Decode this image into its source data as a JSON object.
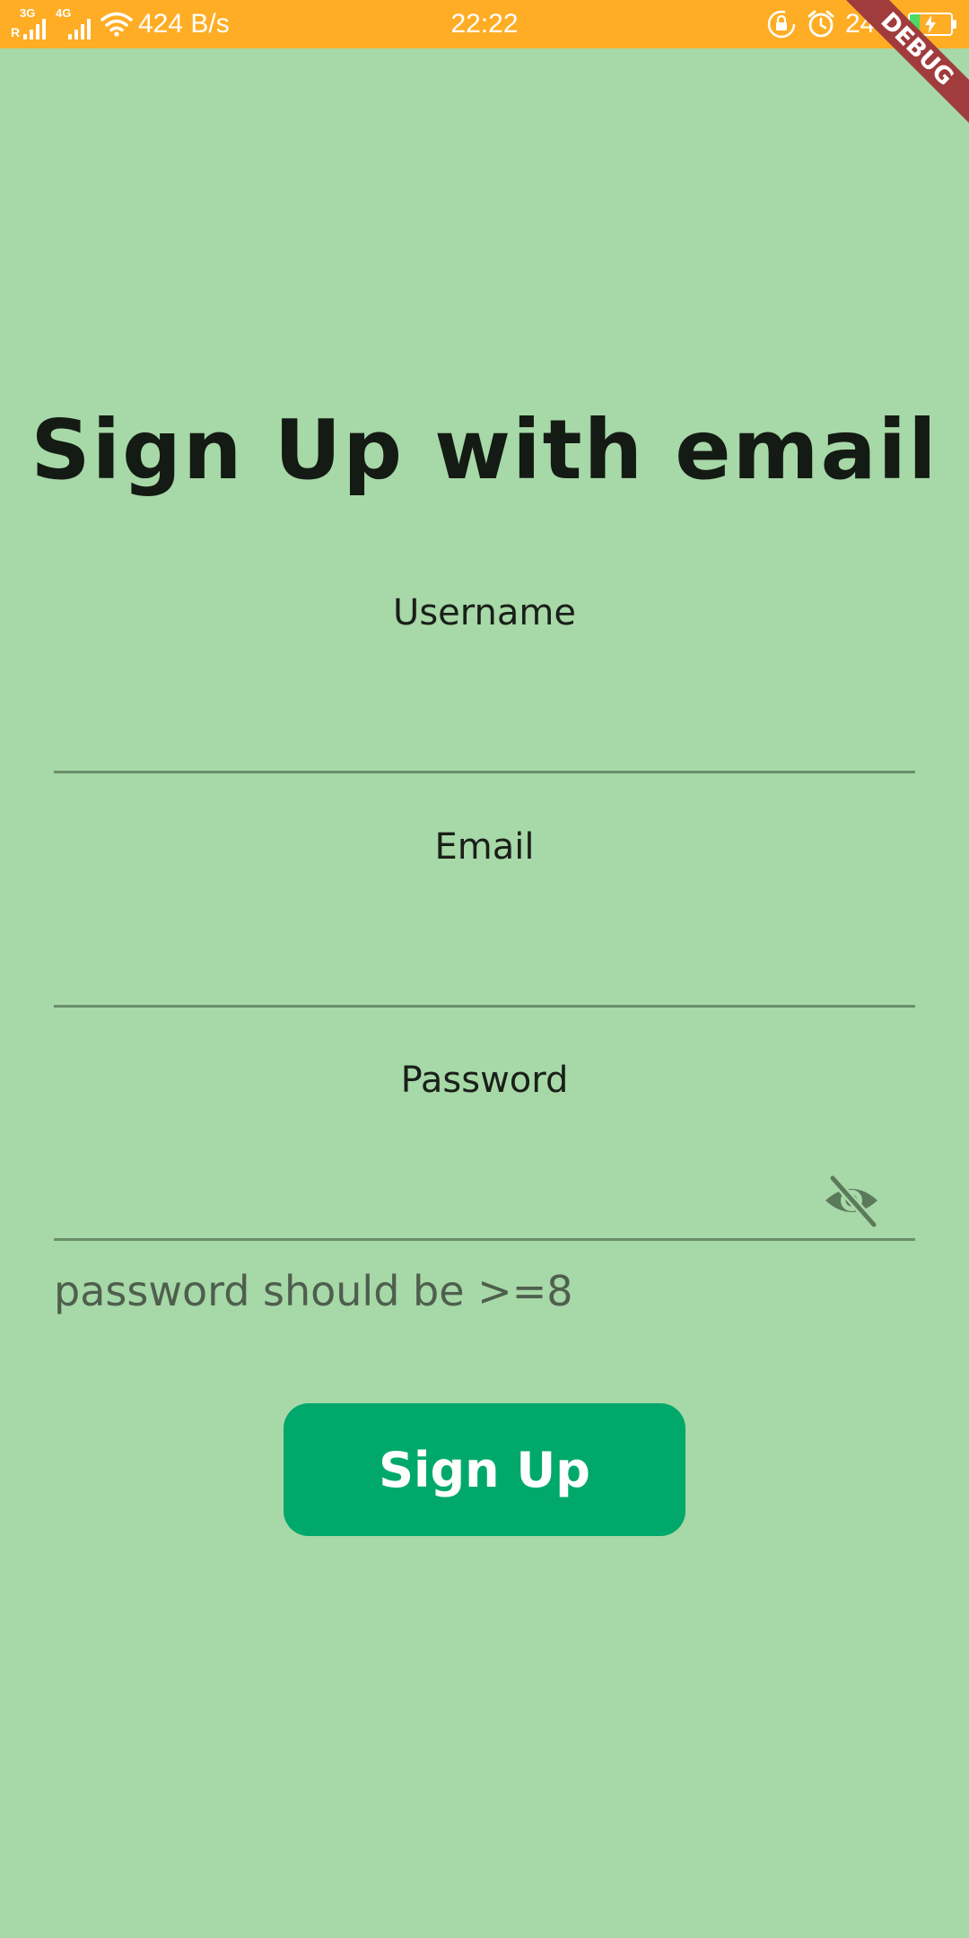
{
  "status_bar": {
    "sim1_network": "3G",
    "sim1_roaming": "R",
    "sim2_network": "4G",
    "net_speed": "424 B/s",
    "time": "22:22",
    "battery_percent_label": "24%",
    "battery_level": 0.24,
    "bar_color": "#ffad25",
    "battery_fill_color": "#4cd964"
  },
  "debug_banner": {
    "label": "DEBUG"
  },
  "form": {
    "title": "Sign Up with email",
    "username_label": "Username",
    "username_value": "",
    "email_label": "Email",
    "email_value": "",
    "password_label": "Password",
    "password_value": "",
    "password_visibility_icon": "visibility-off-icon",
    "password_helper": "password should be >=8",
    "submit_label": "Sign Up"
  },
  "colors": {
    "background": "#a7d8a7",
    "button": "#00a96b",
    "underline": "#6a8e6a",
    "helper_text": "#4e5f4e",
    "debug_ribbon": "#a13c3c"
  }
}
